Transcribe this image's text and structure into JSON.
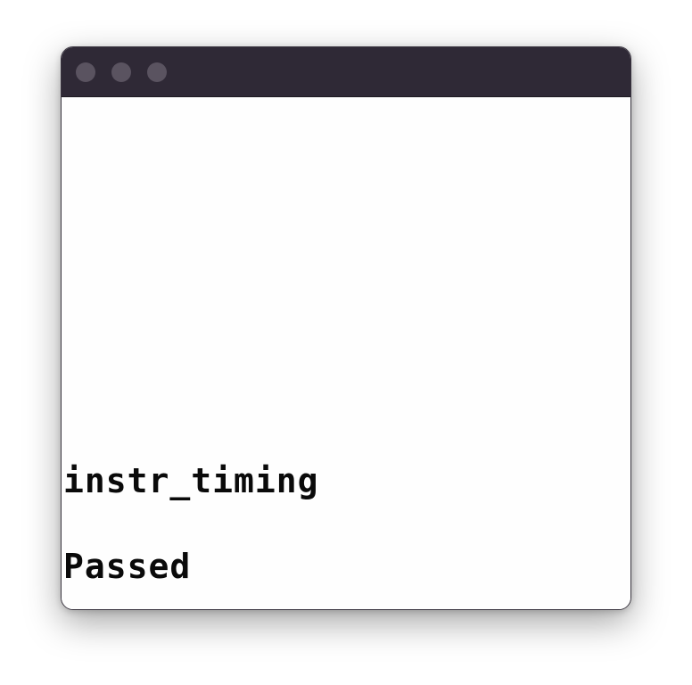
{
  "window": {
    "controls": [
      "close-icon",
      "minimize-icon",
      "zoom-icon"
    ]
  },
  "screen": {
    "test_name": "instr_timing",
    "result": "Passed"
  }
}
